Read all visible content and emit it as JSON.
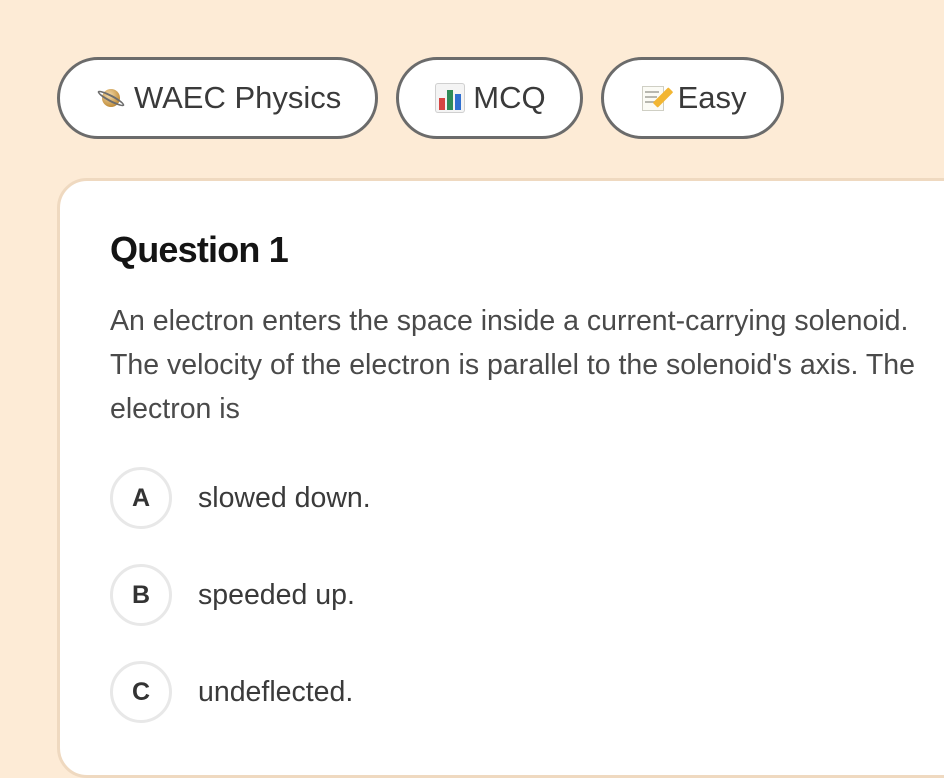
{
  "chips": [
    {
      "icon": "planet-icon",
      "label": "WAEC Physics"
    },
    {
      "icon": "bar-chart-icon",
      "label": "MCQ"
    },
    {
      "icon": "memo-icon",
      "label": "Easy"
    }
  ],
  "question": {
    "title": "Question 1",
    "text": "An electron enters the space inside a current-carrying solenoid. The velocity of the electron is parallel to the solenoid's axis. The electron is",
    "options": [
      {
        "letter": "A",
        "text": "slowed down."
      },
      {
        "letter": "B",
        "text": "speeded up."
      },
      {
        "letter": "C",
        "text": "undeflected."
      }
    ]
  },
  "colors": {
    "page_background": "#fdebd6",
    "card_border": "#efd9c0",
    "chip_border": "#6b6b6b"
  }
}
